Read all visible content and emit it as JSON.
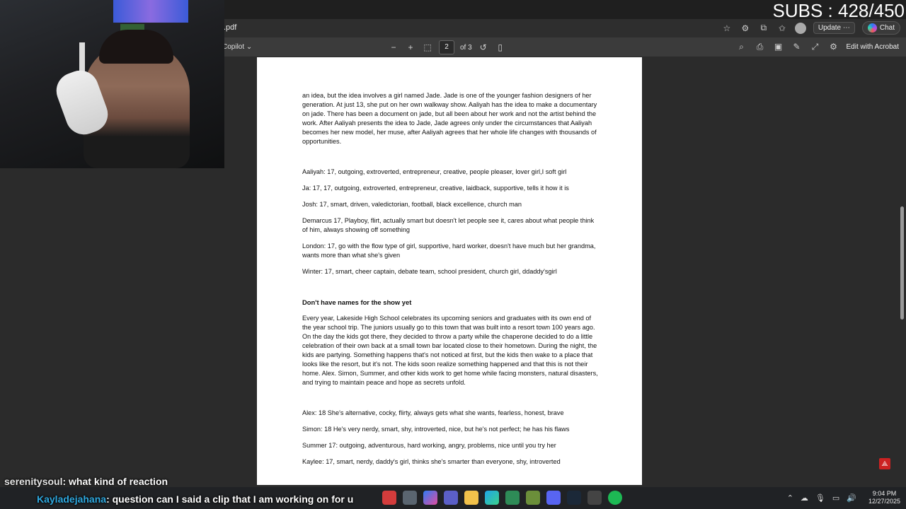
{
  "stream": {
    "subs_text": "SUBS : 428/450"
  },
  "browser": {
    "address_text": ".pdf",
    "update_label": "Update",
    "chat_label": "Chat"
  },
  "pdf_toolbar": {
    "copilot_label": "Copilot",
    "current_page": "2",
    "of_pages": "of 3",
    "edit_label": "Edit with Acrobat"
  },
  "document": {
    "intro": "an idea, but the idea involves a girl named Jade. Jade is one of the younger fashion designers of her generation. At just 13, she put on her own walkway show. Aaliyah has the idea to make a documentary on jade. There has been a document on jade, but all been about her work and not the artist behind the work. After Aaliyah presents the idea to Jade, Jade agrees only under the circumstances that Aaliyah becomes her new model, her muse, after Aaliyah agrees that her whole life changes with thousands of opportunities.",
    "characters_1": [
      "Aaliyah: 17, outgoing, extroverted, entrepreneur, creative, people pleaser, lover girl,I soft girl",
      "Ja: 17, 17, outgoing, extroverted, entrepreneur, creative, laidback, supportive, tells it how it is",
      "Josh: 17, smart, driven, valedictorian, football, black excellence, church man",
      "Demarcus 17, Playboy, flirt, actually smart but doesn't let people see it, cares about what people think of him, always showing off something",
      "London: 17, go with the flow type of girl, supportive, hard worker, doesn't have much but her grandma, wants more than what she's given",
      "Winter: 17, smart, cheer captain, debate team, school president, church girl, ddaddy'sgirl"
    ],
    "heading_2": "Don't have names for the show yet",
    "synopsis_2": "Every year, Lakeside High School celebrates its upcoming seniors and graduates with its own end of the year school trip. The juniors usually go to this town that was built into a resort town 100 years ago. On the day the kids got there, they decided to throw a party while the chaperone decided to do a little celebration of their own back at a small town bar located close to their hometown. During the night, the kids are partying. Something happens that's not noticed at first, but the kids then wake to a place that looks like the resort, but it's not. The kids soon realize something happened and that this is not their home. Alex. Simon, Summer, and other kids work to get home while facing monsters, natural disasters, and trying to maintain peace and hope as secrets unfold.",
    "characters_2": [
      "Alex: 18 She's alternative, cocky, flirty, always gets what she wants, fearless, honest, brave",
      "Simon: 18 He's very nerdy, smart, shy, introverted, nice, but he's not perfect; he has his flaws",
      "Summer 17: outgoing, adventurous, hard working, angry, problems, nice until you try her",
      "Kaylee: 17, smart, nerdy, daddy's girl, thinks she's smarter than everyone, shy, introverted"
    ]
  },
  "chat": [
    {
      "user": "serenitysoul",
      "message": ": what kind of reaction"
    },
    {
      "user": "Kayladejahana",
      "message": ": question can I said a clip that I am working on for u"
    }
  ],
  "taskbar": {
    "time": "9:04 PM",
    "date": "12/27/2025"
  }
}
